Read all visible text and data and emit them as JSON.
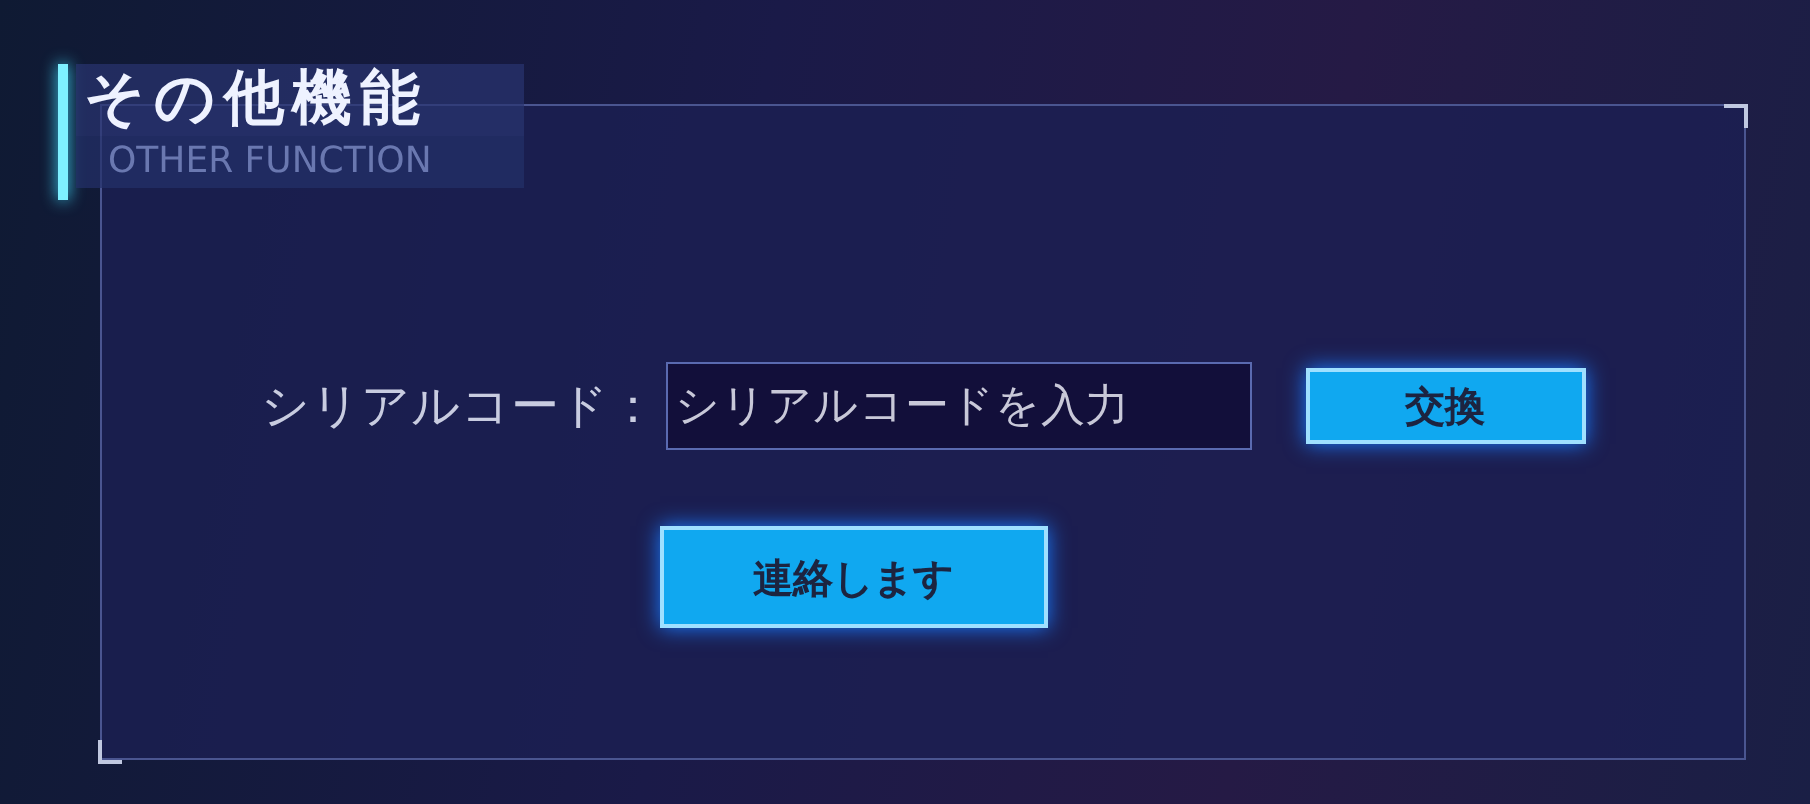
{
  "title": "その他機能",
  "subtitle": "OTHER FUNCTION",
  "serial": {
    "label": "シリアルコード：",
    "placeholder": "シリアルコードを入力"
  },
  "buttons": [
    {
      "label": "交換"
    },
    {
      "label": "連絡します"
    }
  ]
}
